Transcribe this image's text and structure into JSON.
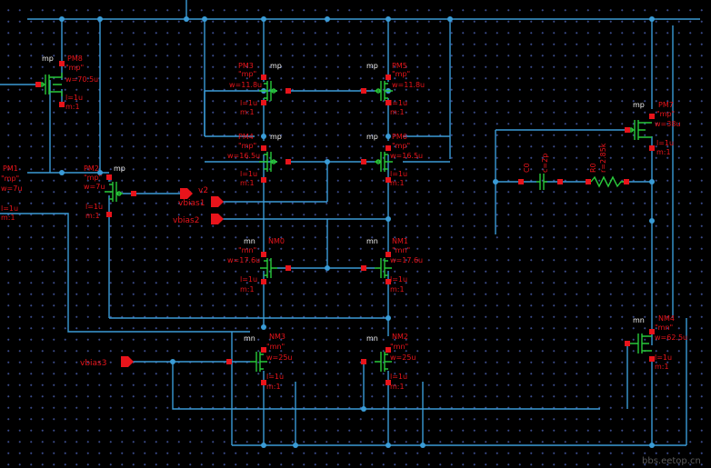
{
  "schematic": {
    "transistors": [
      {
        "id": "pm8",
        "name": "PM8",
        "type": "mp",
        "model": "\"mp\"",
        "w": "w=70.5u",
        "l": "l=1u",
        "m": "m:1"
      },
      {
        "id": "pm3",
        "name": "PM3",
        "type": "mp",
        "model": "\"mp\"",
        "w": "w=11.8u",
        "l": "l=1u",
        "m": "m:1"
      },
      {
        "id": "pm5",
        "name": "PM5",
        "type": "mp",
        "model": "\"mp\"",
        "w": "w=11.8u",
        "l": "l=1u",
        "m": "m:1"
      },
      {
        "id": "pm4",
        "name": "PM4",
        "type": "mp",
        "model": "\"mp\"",
        "w": "w=16.5u",
        "l": "l=1u",
        "m": "m:1"
      },
      {
        "id": "pm6",
        "name": "PM6",
        "type": "mp",
        "model": "\"mp\"",
        "w": "w=16.5u",
        "l": "l=1u",
        "m": "m:1"
      },
      {
        "id": "pm2",
        "name": "PM2",
        "type": "mp",
        "model": "\"mp\"",
        "w": "w=7u",
        "l": "l=1u",
        "m": "m:1"
      },
      {
        "id": "pm1",
        "name": "PM1",
        "type": "",
        "model": "\"mp\"",
        "w": "w=7u",
        "l": "l=1u",
        "m": "m:1"
      },
      {
        "id": "pm7",
        "name": "PM7",
        "type": "mp",
        "model": "\"mp\"",
        "w": "w=38u",
        "l": "l=1u",
        "m": "m:1"
      },
      {
        "id": "nm0",
        "name": "NM0",
        "type": "mn",
        "model": "\"mn\"",
        "w": "w=17.6u",
        "l": "l=1u",
        "m": "m:1"
      },
      {
        "id": "nm1",
        "name": "NM1",
        "type": "mn",
        "model": "\"mn\"",
        "w": "w=17.6u",
        "l": "l=1u",
        "m": "m:1"
      },
      {
        "id": "nm3",
        "name": "NM3",
        "type": "mn",
        "model": "\"mn\"",
        "w": "w=25u",
        "l": "l=1u",
        "m": "m:1"
      },
      {
        "id": "nm2",
        "name": "NM2",
        "type": "mn",
        "model": "\"mn\"",
        "w": "w=25u",
        "l": "l=1u",
        "m": "m:1"
      },
      {
        "id": "nm4",
        "name": "NM4",
        "type": "mn",
        "model": "\"mn\"",
        "w": "w=62.5u",
        "l": "l=1u",
        "m": "m:1"
      }
    ],
    "capacitor": {
      "name": "C0",
      "value": "c=2p"
    },
    "resistor": {
      "name": "R0",
      "value": "r=2.85k"
    },
    "pins": {
      "v2": "v2",
      "vbias1": "vbias1",
      "vbias2": "vbias2",
      "vbias3": "vbias3"
    },
    "watermark": "bbs.eetop.cn",
    "colors": {
      "wire": "#3a9bd6",
      "device": "#29c93a",
      "label": "#e8141b",
      "background": "#000000"
    }
  }
}
